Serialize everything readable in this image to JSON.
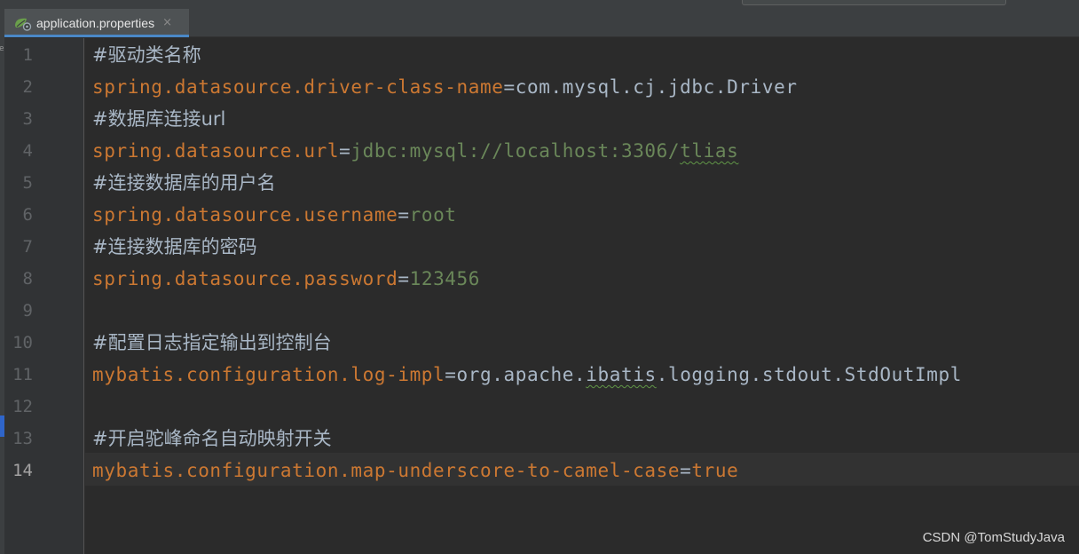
{
  "tab": {
    "label": "application.properties",
    "close": "×"
  },
  "active_line": 14,
  "lines": [
    {
      "n": "1",
      "parts": [
        {
          "cls": "comment",
          "t": "#驱动类名称"
        }
      ]
    },
    {
      "n": "2",
      "parts": [
        {
          "cls": "key",
          "t": "spring.datasource.driver-class-name"
        },
        {
          "cls": "eq",
          "t": "="
        },
        {
          "cls": "valb",
          "t": "com.mysql.cj.jdbc.Driver"
        }
      ]
    },
    {
      "n": "3",
      "parts": [
        {
          "cls": "comment",
          "t": "#数据库连接url"
        }
      ]
    },
    {
      "n": "4",
      "parts": [
        {
          "cls": "key",
          "t": "spring.datasource.url"
        },
        {
          "cls": "eq",
          "t": "="
        },
        {
          "cls": "val",
          "t": "jdbc:mysql://localhost:3306/"
        },
        {
          "cls": "val sq",
          "t": "tlias"
        }
      ]
    },
    {
      "n": "5",
      "parts": [
        {
          "cls": "comment",
          "t": "#连接数据库的用户名"
        }
      ]
    },
    {
      "n": "6",
      "parts": [
        {
          "cls": "key",
          "t": "spring.datasource.username"
        },
        {
          "cls": "eq",
          "t": "="
        },
        {
          "cls": "val",
          "t": "root"
        }
      ]
    },
    {
      "n": "7",
      "parts": [
        {
          "cls": "comment",
          "t": "#连接数据库的密码"
        }
      ]
    },
    {
      "n": "8",
      "parts": [
        {
          "cls": "key",
          "t": "spring.datasource.password"
        },
        {
          "cls": "eq",
          "t": "="
        },
        {
          "cls": "val",
          "t": "123456"
        }
      ]
    },
    {
      "n": "9",
      "parts": []
    },
    {
      "n": "10",
      "parts": [
        {
          "cls": "comment",
          "t": "#配置日志指定输出到控制台"
        }
      ]
    },
    {
      "n": "11",
      "parts": [
        {
          "cls": "key",
          "t": "mybatis.configuration.log-impl"
        },
        {
          "cls": "eq",
          "t": "="
        },
        {
          "cls": "valb",
          "t": "org.apache."
        },
        {
          "cls": "valb sq",
          "t": "ibatis"
        },
        {
          "cls": "valb",
          "t": ".logging.stdout.StdOutImpl"
        }
      ]
    },
    {
      "n": "12",
      "parts": []
    },
    {
      "n": "13",
      "parts": [
        {
          "cls": "comment",
          "t": "#开启驼峰命名自动映射开关"
        }
      ]
    },
    {
      "n": "14",
      "parts": [
        {
          "cls": "key",
          "t": "mybatis.configuration.map-underscore-to-camel-case"
        },
        {
          "cls": "eq",
          "t": "="
        },
        {
          "cls": "valo",
          "t": "true"
        }
      ]
    }
  ],
  "watermark": "CSDN @TomStudyJava",
  "colors": {
    "key": "#cc7832",
    "value": "#6a8759",
    "text": "#a9b7c6",
    "background": "#2b2b2b"
  }
}
